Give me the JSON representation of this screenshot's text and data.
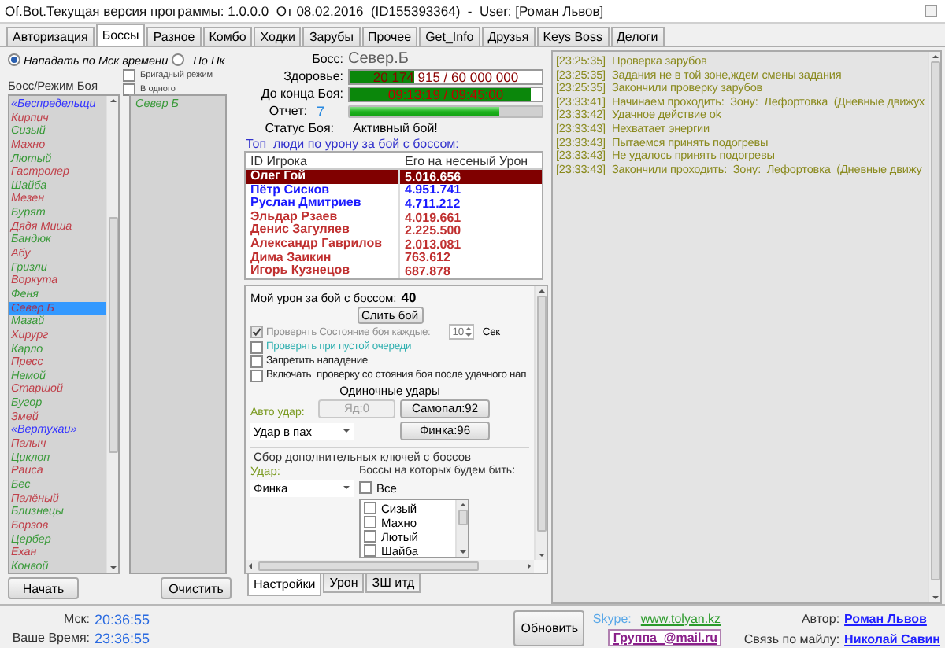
{
  "window": {
    "title": "Of.Bot.Текущая версия программы: 1.0.0.0  От 08.02.2016  (ID155393364)  -  User: [Роман Львов]"
  },
  "tabs": [
    {
      "label": "Авторизация",
      "selected": false
    },
    {
      "label": "Боссы",
      "selected": true
    },
    {
      "label": "Разное",
      "selected": false
    },
    {
      "label": "Комбо",
      "selected": false
    },
    {
      "label": "Ходки",
      "selected": false
    },
    {
      "label": "Зарубы",
      "selected": false
    },
    {
      "label": "Прочее",
      "selected": false
    },
    {
      "label": "Get_Info",
      "selected": false
    },
    {
      "label": "Друзья",
      "selected": false
    },
    {
      "label": "Keys Boss",
      "selected": false
    },
    {
      "label": "Делоги",
      "selected": false
    }
  ],
  "attack_mode": [
    {
      "label": "Нападать по Мск времени",
      "selected": true
    },
    {
      "label": "По Пк",
      "selected": false
    }
  ],
  "mode_checks": [
    {
      "label": "Бригадный режим",
      "checked": false
    },
    {
      "label": "В одного",
      "checked": false
    }
  ],
  "boss_list": {
    "label": "Босс/Режим Боя",
    "items": [
      {
        "name": "«Беспредельщи",
        "color": "#3333ff",
        "selected": false
      },
      {
        "name": "Кирпич",
        "color": "#c0404a",
        "selected": false
      },
      {
        "name": "Сизый",
        "color": "#3a9a3a",
        "selected": false
      },
      {
        "name": "Махно",
        "color": "#c0404a",
        "selected": false
      },
      {
        "name": "Лютый",
        "color": "#3a9a3a",
        "selected": false
      },
      {
        "name": "Гастролер",
        "color": "#c0404a",
        "selected": false
      },
      {
        "name": "Шайба",
        "color": "#3a9a3a",
        "selected": false
      },
      {
        "name": "Мезен",
        "color": "#c0404a",
        "selected": false
      },
      {
        "name": "Бурят",
        "color": "#3a9a3a",
        "selected": false
      },
      {
        "name": "Дядя Миша",
        "color": "#c0404a",
        "selected": false
      },
      {
        "name": "Бандюк",
        "color": "#3a9a3a",
        "selected": false
      },
      {
        "name": "Абу",
        "color": "#c0404a",
        "selected": false
      },
      {
        "name": "Гризли",
        "color": "#3a9a3a",
        "selected": false
      },
      {
        "name": "Воркута",
        "color": "#c0404a",
        "selected": false
      },
      {
        "name": "Феня",
        "color": "#3a9a3a",
        "selected": false
      },
      {
        "name": "Север Б",
        "selected": true
      },
      {
        "name": "Мазай",
        "color": "#3a9a3a",
        "selected": false
      },
      {
        "name": "Хирург",
        "color": "#c0404a",
        "selected": false
      },
      {
        "name": "Карло",
        "color": "#3a9a3a",
        "selected": false
      },
      {
        "name": "Пресс",
        "color": "#c0404a",
        "selected": false
      },
      {
        "name": "Немой",
        "color": "#3a9a3a",
        "selected": false
      },
      {
        "name": "Старшой",
        "color": "#c0404a",
        "selected": false
      },
      {
        "name": "Бугор",
        "color": "#3a9a3a",
        "selected": false
      },
      {
        "name": "Змей",
        "color": "#c0404a",
        "selected": false
      },
      {
        "name": "«Вертухаи»",
        "color": "#3333ff",
        "selected": false
      },
      {
        "name": "Палыч",
        "color": "#c0404a",
        "selected": false
      },
      {
        "name": "Циклоп",
        "color": "#3a9a3a",
        "selected": false
      },
      {
        "name": "Раиса",
        "color": "#c0404a",
        "selected": false
      },
      {
        "name": "Бес",
        "color": "#3a9a3a",
        "selected": false
      },
      {
        "name": "Палёный",
        "color": "#c0404a",
        "selected": false
      },
      {
        "name": "Близнецы",
        "color": "#3a9a3a",
        "selected": false
      },
      {
        "name": "Борзов",
        "color": "#c0404a",
        "selected": false
      },
      {
        "name": "Цербер",
        "color": "#3a9a3a",
        "selected": false
      },
      {
        "name": "Ехан",
        "color": "#c0404a",
        "selected": false
      },
      {
        "name": "Конвой",
        "color": "#3a9a3a",
        "selected": false
      }
    ]
  },
  "chosen_list": [
    "Север Б"
  ],
  "start_button": "Начать",
  "clear_button": "Очистить",
  "boss": {
    "label": "Босс:",
    "name": "Север.Б"
  },
  "health": {
    "label": "Здоровье:",
    "reading": "20 174 915 / 60 000 000",
    "level": 0.336
  },
  "time_left": {
    "label": "До конца Боя:",
    "reading": "09:13:19 / 09:45:00",
    "level": 0.945
  },
  "report": {
    "label": "Отчет:",
    "value": "7",
    "level": 0.78
  },
  "status": {
    "label": "Статус Боя:",
    "value": "Активный бой!"
  },
  "top_title": "Топ  люди по урону за бой с боссом:",
  "damage_table": {
    "columns": [
      "ID Игрока",
      "Его на несеный Урон"
    ],
    "rows": [
      {
        "player": "Олег Гой",
        "damage": "5.016.656",
        "color": "#800000",
        "selected": true
      },
      {
        "player": "Пётр Сисков",
        "damage": "4.951.741",
        "color": "#1a1aff",
        "selected": false
      },
      {
        "player": "Руслан Дмитриев",
        "damage": "4.711.212",
        "color": "#1a1aff",
        "selected": false
      },
      {
        "player": "Эльдар Рзаев",
        "damage": "4.019.661",
        "color": "#c03030",
        "selected": false
      },
      {
        "player": "Денис Загуляев",
        "damage": "2.225.500",
        "color": "#c03030",
        "selected": false
      },
      {
        "player": "Александр Гаврилов",
        "damage": "2.013.081",
        "color": "#c03030",
        "selected": false
      },
      {
        "player": "Дима Заикин",
        "damage": "763.612",
        "color": "#c03030",
        "selected": false
      },
      {
        "player": "Игорь Кузнецов",
        "damage": "687.878",
        "color": "#c03030",
        "selected": false
      }
    ]
  },
  "fight": {
    "my_damage_label": "Мой урон за бой с боссом:",
    "my_damage": "40",
    "drain_button": "Слить бой",
    "options": [
      {
        "kind": "interval",
        "label": "Проверять Состояние боя каждые:",
        "checked": true,
        "color": "#909090",
        "value": "10",
        "unit": "Сек"
      },
      {
        "kind": "plain",
        "label": "Проверять при пустой очереди",
        "checked": false,
        "color": "#30b0b0"
      },
      {
        "kind": "plain",
        "label": "Запретить нападение",
        "checked": false,
        "color": "#202020"
      },
      {
        "kind": "plain",
        "label": "Включать  проверку со стояния боя после удачного нап",
        "checked": false,
        "color": "#202020"
      }
    ]
  },
  "single_hits": {
    "title": "Одиночные удары",
    "auto_label": "Авто удар:",
    "auto_select": "Удар в пах",
    "buttons": [
      {
        "label": "Яд:0",
        "disabled": true
      },
      {
        "label": "Самопал:92",
        "disabled": false
      },
      {
        "label": "Финка:96",
        "disabled": false
      }
    ]
  },
  "keys": {
    "title": "Сбор дополнительных ключей с боссов",
    "hit_label": "Удар:",
    "hit_select": "Финка",
    "bosses_label": "Боссы на которых будем бить:",
    "all": {
      "label": "Все",
      "checked": false
    },
    "bosses": [
      {
        "name": "Сизый",
        "checked": false
      },
      {
        "name": "Махно",
        "checked": false
      },
      {
        "name": "Лютый",
        "checked": false
      },
      {
        "name": "Шайба",
        "checked": false
      }
    ]
  },
  "sub_tabs": [
    {
      "label": "Настройки",
      "selected": true
    },
    {
      "label": "Урон",
      "selected": false
    },
    {
      "label": "ЗШ итд",
      "selected": false
    }
  ],
  "log": [
    {
      "time": "[23:25:35]",
      "text": "Проверка зарубов"
    },
    {
      "time": "[23:25:35]",
      "text": "Задания не в той зоне,ждем смены задания"
    },
    {
      "time": "[23:25:35]",
      "text": "Закончили проверку зарубов"
    },
    {
      "time": "[23:33:41]",
      "text": "Начинаем проходить:  Зону:  Лефортовка  (Дневные движух"
    },
    {
      "time": "[23:33:42]",
      "text": "Удачное действие ok"
    },
    {
      "time": "[23:33:43]",
      "text": "Нехватает энергии"
    },
    {
      "time": "[23:33:43]",
      "text": "Пытаемся принять подогревы"
    },
    {
      "time": "[23:33:43]",
      "text": "Не удалось принять подогревы"
    },
    {
      "time": "[23:33:43]",
      "text": "Закончили проходить:  Зону:  Лефортовка  (Дневные движу"
    }
  ],
  "footer": {
    "msk_label": "Мск:",
    "msk_time": "20:36:55",
    "local_label": "Ваше Время:",
    "local_time": "23:36:55",
    "refresh_button": "Обновить",
    "skype_label": "Skype:",
    "skype_link": "www.tolyan.kz",
    "group_link": "Группа  @mail.ru",
    "author_label": "Автор:",
    "author": "Роман Львов",
    "mail_label": "Связь по майлу:",
    "mail_contact": "Николай Савин"
  }
}
